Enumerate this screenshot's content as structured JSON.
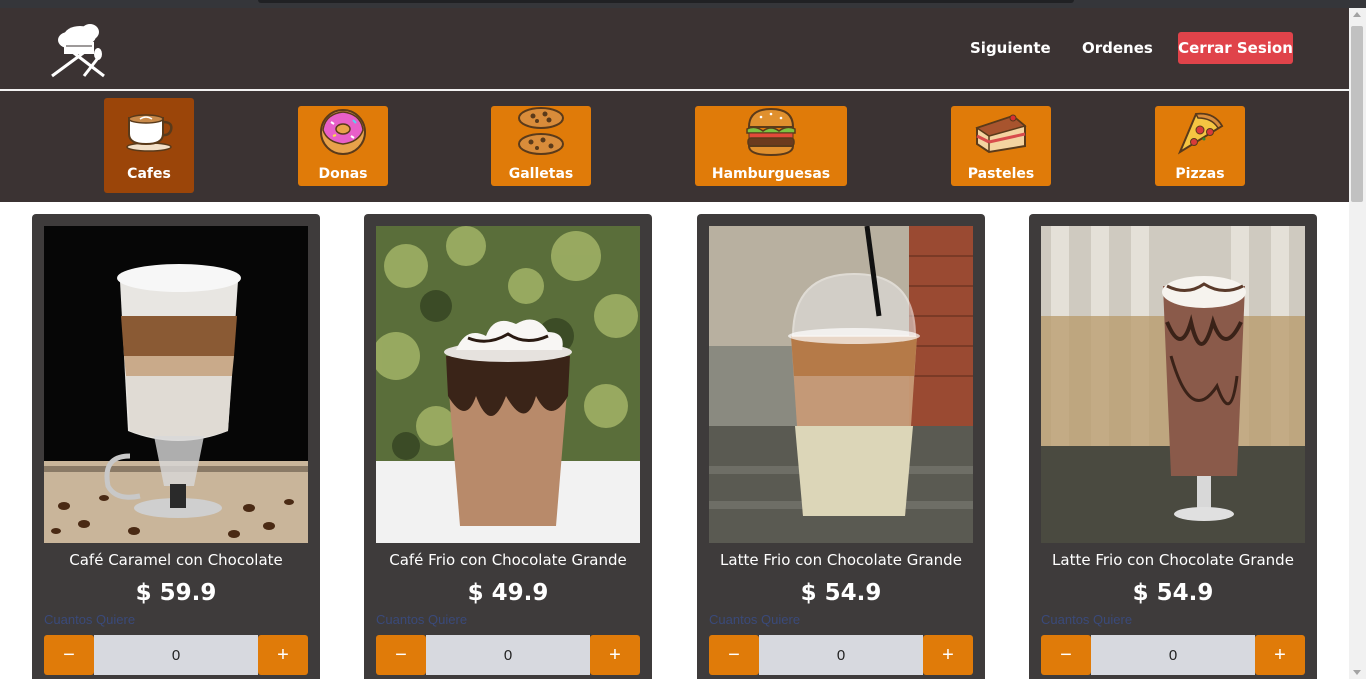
{
  "nav": {
    "logo_icon": "chef-hat-utensils-icon",
    "next_label": "Siguiente",
    "orders_label": "Ordenes",
    "logout_label": "Cerrar Sesion"
  },
  "categories": [
    {
      "label": "Cafes",
      "icon": "coffee-cup-icon",
      "active": true
    },
    {
      "label": "Donas",
      "icon": "donut-icon",
      "active": false
    },
    {
      "label": "Galletas",
      "icon": "cookies-icon",
      "active": false
    },
    {
      "label": "Hamburguesas",
      "icon": "burger-icon",
      "active": false
    },
    {
      "label": "Pasteles",
      "icon": "cake-icon",
      "active": false
    },
    {
      "label": "Pizzas",
      "icon": "pizza-icon",
      "active": false
    }
  ],
  "products": [
    {
      "name": "Café Caramel con Chocolate",
      "price": "$ 59.9",
      "qty_label": "Cuantos Quiere",
      "qty": "0",
      "minus": "−",
      "plus": "+"
    },
    {
      "name": "Café Frio con Chocolate Grande",
      "price": "$ 49.9",
      "qty_label": "Cuantos Quiere",
      "qty": "0",
      "minus": "−",
      "plus": "+"
    },
    {
      "name": "Latte Frio con Chocolate Grande",
      "price": "$ 54.9",
      "qty_label": "Cuantos Quiere",
      "qty": "0",
      "minus": "−",
      "plus": "+"
    },
    {
      "name": "Latte Frio con Chocolate Grande",
      "price": "$ 54.9",
      "qty_label": "Cuantos Quiere",
      "qty": "0",
      "minus": "−",
      "plus": "+"
    }
  ],
  "colors": {
    "nav_bg": "#3b3333",
    "accent": "#e07b09",
    "accent_active": "#9b4509",
    "logout": "#e0434a",
    "card_bg": "#3e3b3b"
  }
}
